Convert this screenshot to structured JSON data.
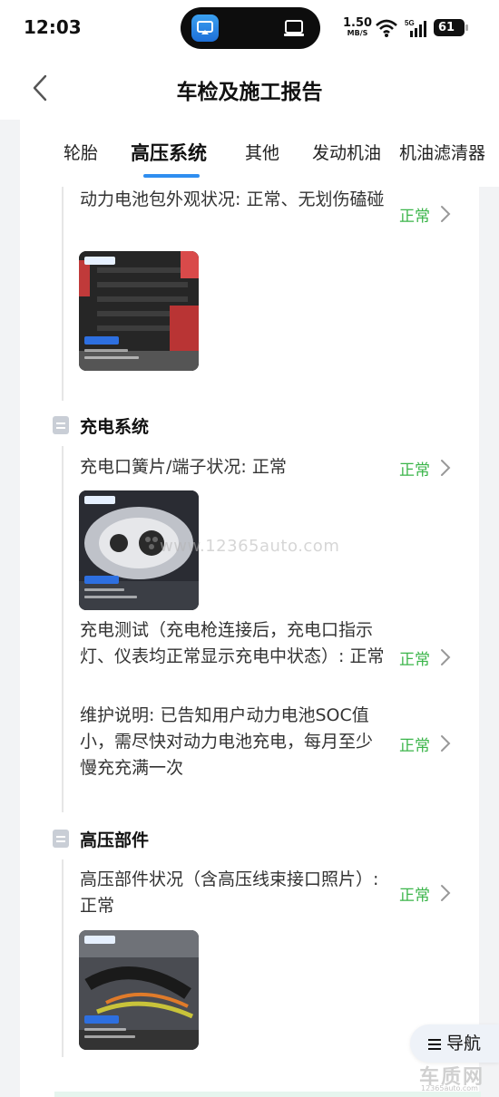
{
  "status_bar": {
    "time": "12:03",
    "net_speed": "1.50",
    "net_unit": "MB/S",
    "network": "5G",
    "battery": "61"
  },
  "header": {
    "title": "车检及施工报告"
  },
  "tabs": [
    {
      "label": "轮胎",
      "active": false
    },
    {
      "label": "高压系统",
      "active": true
    },
    {
      "label": "其他",
      "active": false
    },
    {
      "label": "发动机油",
      "active": false
    },
    {
      "label": "机油滤清器",
      "active": false
    }
  ],
  "sections": {
    "battery_pack": {
      "item_text": "动力电池包外观状况: 正常、无划伤磕碰",
      "status": "正常"
    },
    "charging": {
      "title": "充电系统",
      "items": [
        {
          "text": "充电口簧片/端子状况: 正常",
          "status": "正常"
        },
        {
          "text": "充电测试（充电枪连接后，充电口指示灯、仪表均正常显示充电中状态）: 正常",
          "status": "正常"
        },
        {
          "text": "维护说明: 已告知用户动力电池SOC值小，需尽快对动力电池充电，每月至少慢充充满一次",
          "status": "正常"
        }
      ]
    },
    "hv_parts": {
      "title": "高压部件",
      "item_text": "高压部件状况（含高压线束接口照片）: 正常",
      "status": "正常"
    }
  },
  "watermark": "www.12365auto.com",
  "nav_button": "导航",
  "logo": {
    "text": "车质网",
    "sub": "12365auto.com"
  },
  "colors": {
    "status_green": "#3bb54a",
    "tab_accent": "#2f8ef0",
    "page_bg": "#f2f3f5"
  }
}
